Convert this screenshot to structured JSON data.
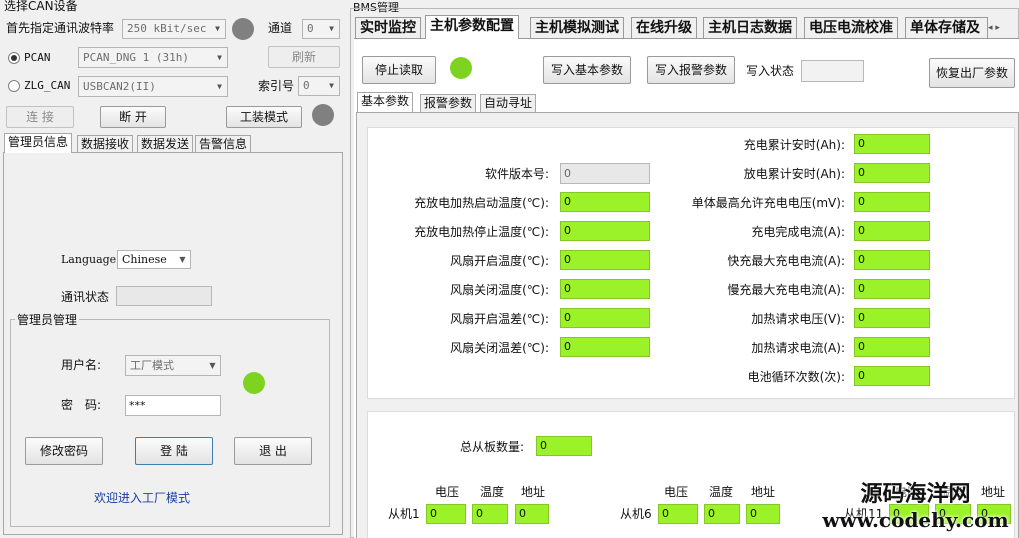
{
  "can": {
    "title": "选择CAN设备",
    "baud_label": "首先指定通讯波特率",
    "baud_value": "250 kBit/sec",
    "channel_label": "通道",
    "channel_value": "0",
    "pcan_label": "PCAN",
    "pcan_value": "PCAN_DNG 1 (31h)",
    "refresh_label": "刷新",
    "zlg_label": "ZLG_CAN",
    "zlg_value": "USBCAN2(II)",
    "index_label": "索引号",
    "index_value": "0",
    "connect_label": "连 接",
    "disconnect_label": "断 开",
    "factory_mode_label": "工装模式"
  },
  "left_tabs": [
    {
      "label": "管理员信息"
    },
    {
      "label": "数据接收"
    },
    {
      "label": "数据发送"
    },
    {
      "label": "告警信息"
    }
  ],
  "admin": {
    "language_label": "Language",
    "language_value": "Chinese",
    "comm_status_label": "通讯状态",
    "comm_status_value": "",
    "group_title": "管理员管理",
    "username_label": "用户名:",
    "username_value": "工厂模式",
    "password_label": "密　码:",
    "password_value": "***",
    "change_pw_label": "修改密码",
    "login_label": "登 陆",
    "logout_label": "退 出",
    "welcome": "欢迎进入工厂模式"
  },
  "bms": {
    "title": "BMS管理",
    "tabs": [
      {
        "label": "实时监控"
      },
      {
        "label": "主机参数配置"
      },
      {
        "label": "主机模拟测试"
      },
      {
        "label": "在线升级"
      },
      {
        "label": "主机日志数据"
      },
      {
        "label": "电压电流校准"
      },
      {
        "label": "单体存储及"
      }
    ],
    "stop_read_label": "停止读取",
    "write_basic_label": "写入基本参数",
    "write_alarm_label": "写入报警参数",
    "write_status_label": "写入状态",
    "write_status_value": "",
    "restore_label": "恢复出厂参数",
    "sub_tabs": [
      {
        "label": "基本参数"
      },
      {
        "label": "报警参数"
      },
      {
        "label": "自动寻址"
      }
    ],
    "left_params": [
      {
        "label": "软件版本号:",
        "value": "0",
        "green": false
      },
      {
        "label": "充放电加热启动温度(℃):",
        "value": "0",
        "green": true
      },
      {
        "label": "充放电加热停止温度(℃):",
        "value": "0",
        "green": true
      },
      {
        "label": "风扇开启温度(℃):",
        "value": "0",
        "green": true
      },
      {
        "label": "风扇关闭温度(℃):",
        "value": "0",
        "green": true
      },
      {
        "label": "风扇开启温差(℃):",
        "value": "0",
        "green": true
      },
      {
        "label": "风扇关闭温差(℃):",
        "value": "0",
        "green": true
      }
    ],
    "right_params": [
      {
        "label": "充电累计安时(Ah):",
        "value": "0"
      },
      {
        "label": "放电累计安时(Ah):",
        "value": "0"
      },
      {
        "label": "单体最高允许充电电压(mV):",
        "value": "0"
      },
      {
        "label": "充电完成电流(A):",
        "value": "0"
      },
      {
        "label": "快充最大充电电流(A):",
        "value": "0"
      },
      {
        "label": "慢充最大充电电流(A):",
        "value": "0"
      },
      {
        "label": "加热请求电压(V):",
        "value": "0"
      },
      {
        "label": "加热请求电流(A):",
        "value": "0"
      },
      {
        "label": "电池循环次数(次):",
        "value": "0"
      }
    ],
    "slave_total_label": "总从板数量:",
    "slave_total_value": "0",
    "col_headers": [
      "电压",
      "温度",
      "地址"
    ],
    "slaves": [
      {
        "label": "从机1",
        "voltage": "0",
        "temp": "0",
        "addr": "0"
      },
      {
        "label": "从机6",
        "voltage": "0",
        "temp": "0",
        "addr": "0"
      },
      {
        "label": "从机11",
        "voltage": "0",
        "temp": "0",
        "addr": "0"
      }
    ]
  },
  "watermark": {
    "line1": "源码海洋网",
    "line2": "www.codehy.com"
  },
  "colors": {
    "status_dot": "#808080",
    "active_dot": "#7ed321",
    "field_green": "#9cf229"
  }
}
